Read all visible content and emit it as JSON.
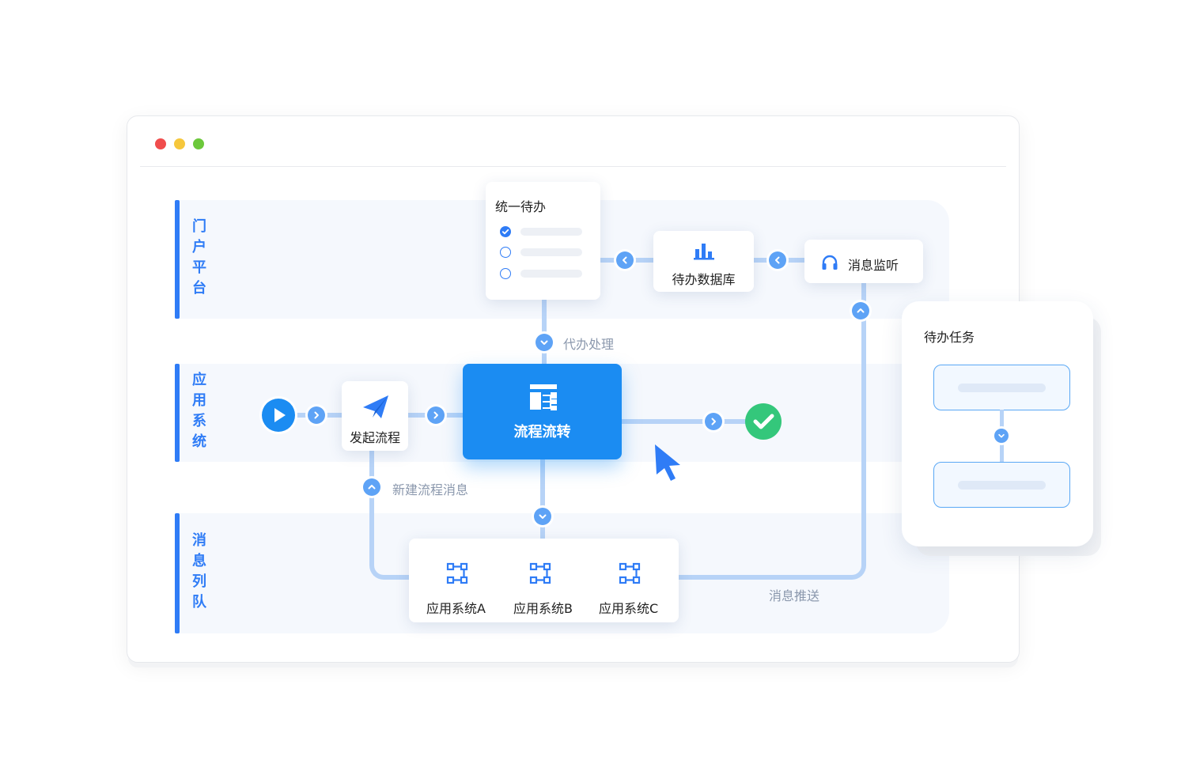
{
  "window": {
    "traffic_lights": [
      "#f04d4d",
      "#f6c73c",
      "#6cc83b"
    ]
  },
  "lanes": [
    {
      "label": "门户平台"
    },
    {
      "label": "应用系统"
    },
    {
      "label": "消息列队"
    }
  ],
  "nodes": {
    "unified_todo": {
      "title": "统一待办"
    },
    "todo_db": {
      "label": "待办数据库"
    },
    "msg_monitor": {
      "label": "消息监听"
    },
    "start_process": {
      "label": "发起流程"
    },
    "process_flow": {
      "label": "流程流转"
    },
    "app_a": {
      "label": "应用系统A"
    },
    "app_b": {
      "label": "应用系统B"
    },
    "app_c": {
      "label": "应用系统C"
    }
  },
  "edge_labels": {
    "delegate": "代办处理",
    "new_msg": "新建流程消息",
    "push": "消息推送"
  },
  "panel": {
    "title": "待办任务"
  },
  "colors": {
    "accent": "#2f7cf6",
    "primary_node": "#1b8cf2",
    "connector": "#b7d3f7",
    "arrow_circle": "#5ea3f6",
    "success": "#34c77b",
    "lane_bg": "#f5f8fd"
  },
  "icons": {
    "play": "play-icon",
    "send": "paper-plane-icon",
    "flow": "flowchart-icon",
    "check": "check-circle-icon",
    "cursor": "mouse-pointer-icon",
    "bar_chart": "bar-chart-icon",
    "headset": "headset-icon",
    "app": "node-graph-icon"
  }
}
